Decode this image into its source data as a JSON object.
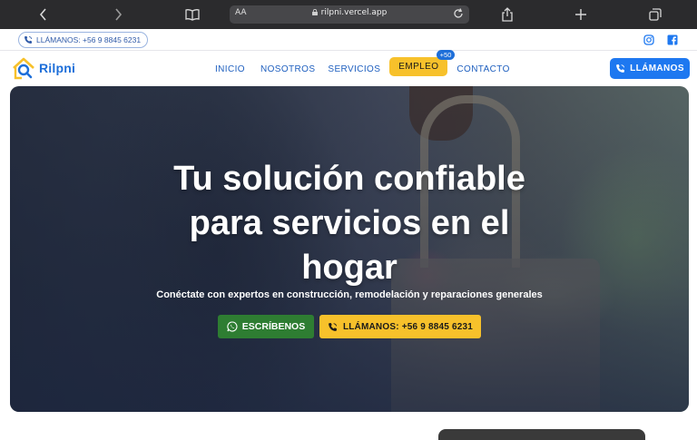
{
  "browser": {
    "aa_label": "AA",
    "url": "rilpni.vercel.app"
  },
  "topbar": {
    "call_label": "LLÁMANOS: +56 9 8845 6231"
  },
  "nav": {
    "logo_text": "Rilpni",
    "links": [
      "INICIO",
      "NOSOTROS",
      "SERVICIOS",
      "EMPLEO",
      "CONTACTO"
    ],
    "empleo_badge": "+50",
    "call_button": "LLÁMANOS"
  },
  "hero": {
    "title_lines": [
      "Tu solución confiable",
      "para servicios en el",
      "hogar"
    ],
    "subtitle": "Conéctate con expertos en construcción, remodelación y reparaciones generales",
    "whatsapp_button": "ESCRÍBENOS",
    "call_button": "LLÁMANOS: +56 9 8845 6231"
  },
  "colors": {
    "brand_blue": "#1e78f0",
    "accent_yellow": "#f7c12b",
    "whatsapp_green": "#2e7d32"
  }
}
